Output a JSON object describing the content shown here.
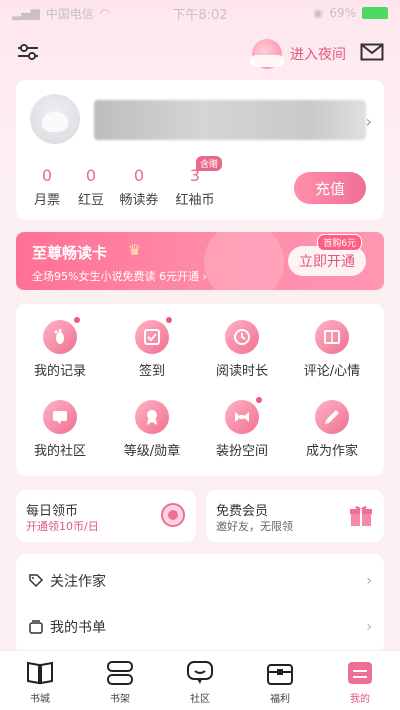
{
  "status_bar": {
    "carrier": "中国电信",
    "time": "下午8:02",
    "battery": "69%"
  },
  "header": {
    "night_mode_label": "进入夜间"
  },
  "profile": {
    "stats": [
      {
        "value": "0",
        "label": "月票"
      },
      {
        "value": "0",
        "label": "红豆"
      },
      {
        "value": "0",
        "label": "畅读券"
      },
      {
        "value": "3",
        "label": "红袖币"
      }
    ],
    "gift_tag": "含赠",
    "recharge_label": "充值"
  },
  "vip": {
    "title": "至尊畅读卡",
    "subtitle": "全场95%女生小说免费读  6元开通 ›",
    "price_tag": "首购6元",
    "button_label": "立即开通"
  },
  "grid": [
    {
      "label": "我的记录",
      "icon": "footprint-icon",
      "dot": true
    },
    {
      "label": "签到",
      "icon": "checkin-icon",
      "dot": true
    },
    {
      "label": "阅读时长",
      "icon": "clock-icon",
      "dot": false
    },
    {
      "label": "评论/心情",
      "icon": "comment-icon",
      "dot": false
    },
    {
      "label": "我的社区",
      "icon": "community-icon",
      "dot": false
    },
    {
      "label": "等级/勋章",
      "icon": "medal-icon",
      "dot": false
    },
    {
      "label": "装扮空间",
      "icon": "bowtie-icon",
      "dot": true
    },
    {
      "label": "成为作家",
      "icon": "pen-icon",
      "dot": false
    }
  ],
  "mini_cards": {
    "coins": {
      "title": "每日领币",
      "subtitle": "开通领10币/日"
    },
    "member": {
      "title": "免费会员",
      "subtitle": "邀好友，无限领"
    }
  },
  "list": [
    {
      "label": "关注作家",
      "icon": "tag-icon"
    },
    {
      "label": "我的书单",
      "icon": "booklist-icon"
    }
  ],
  "tabbar": [
    {
      "label": "书城",
      "icon": "book-open-icon"
    },
    {
      "label": "书架",
      "icon": "bookshelf-icon"
    },
    {
      "label": "社区",
      "icon": "chat-icon"
    },
    {
      "label": "福利",
      "icon": "gift-box-icon"
    },
    {
      "label": "我的",
      "icon": "profile-icon"
    }
  ],
  "colors": {
    "accent": "#e0557a",
    "background": "#fbeff2"
  }
}
